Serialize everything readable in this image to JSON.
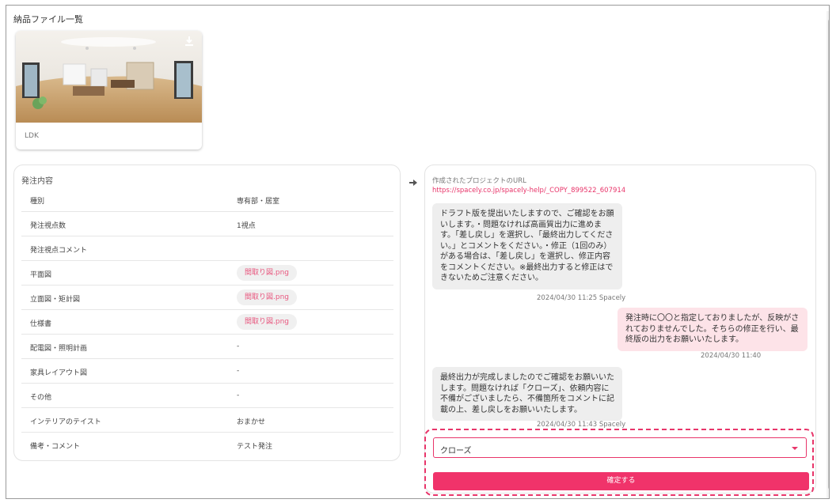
{
  "delivery": {
    "section_title": "納品ファイル一覧",
    "files": [
      {
        "label": "LDK",
        "icon": "download-icon"
      }
    ]
  },
  "order": {
    "title": "発注内容",
    "rows": [
      {
        "key": "種別",
        "value": "専有部・居室"
      },
      {
        "key": "発注視点数",
        "value": "1視点"
      },
      {
        "key": "発注視点コメント",
        "value": ""
      },
      {
        "key": "平面図",
        "chip": "間取り図.png"
      },
      {
        "key": "立面図・矩計図",
        "chip": "間取り図.png"
      },
      {
        "key": "仕様書",
        "chip": "間取り図.png"
      },
      {
        "key": "配電図・照明計画",
        "value": "-"
      },
      {
        "key": "家具レイアウト図",
        "value": "-"
      },
      {
        "key": "その他",
        "value": "-"
      },
      {
        "key": "インテリアのテイスト",
        "value": "おまかせ"
      },
      {
        "key": "備考・コメント",
        "value": "テスト発注"
      }
    ]
  },
  "chat": {
    "url_label": "作成されたプロジェクトのURL",
    "url": "https://spacely.co.jp/spacely-help/_COPY_899522_607914",
    "messages": [
      {
        "side": "left",
        "text": "ドラフト版を提出いたしますので、ご確認をお願いします。・問題なければ高画質出力に進めます。「差し戻し」を選択し、「最終出力してください。」とコメントをください。・修正（1回のみ）がある場合は、「差し戻し」を選択し、修正内容をコメントください。※最終出力すると修正はできないためご注意ください。",
        "meta": "2024/04/30 11:25 Spacely"
      },
      {
        "side": "right",
        "text": "発注時に〇〇と指定しておりましたが、反映がされておりませんでした。そちらの修正を行い、最終版の出力をお願いいたします。",
        "meta": "2024/04/30 11:40"
      },
      {
        "side": "left",
        "text": "最終出力が完成しましたのでご確認をお願いいたします。問題なければ「クローズ」、依頼内容に不備がございましたら、不備箇所をコメントに記載の上、差し戻しをお願いいたします。",
        "meta": "2024/04/30 11:43 Spacely"
      }
    ],
    "select_value": "クローズ",
    "confirm_label": "確定する"
  },
  "colors": {
    "accent": "#f0336a",
    "link": "#e8356a",
    "bubble_left": "#eeeeee",
    "bubble_right": "#fde3e8"
  }
}
